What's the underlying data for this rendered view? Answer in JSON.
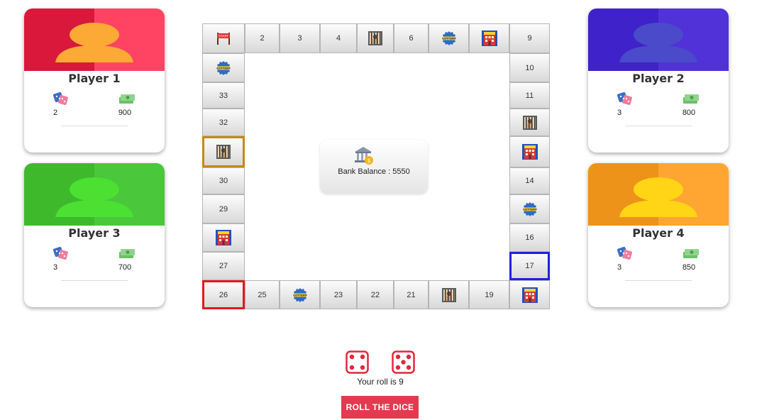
{
  "players": [
    {
      "name": "Player 1",
      "dice": "2",
      "cash": "900",
      "color_left": "#d9183c",
      "color_right": "#ff4463",
      "avatar_color": "#fda935"
    },
    {
      "name": "Player 2",
      "dice": "3",
      "cash": "800",
      "color_left": "#3f22c9",
      "color_right": "#5032d8",
      "avatar_color": "#4a4acb"
    },
    {
      "name": "Player 3",
      "dice": "3",
      "cash": "700",
      "color_left": "#3fb92c",
      "color_right": "#4bc73c",
      "avatar_color": "#4be032"
    },
    {
      "name": "Player 4",
      "dice": "3",
      "cash": "850",
      "color_left": "#ee9319",
      "color_right": "#ffa531",
      "avatar_color": "#ffd516"
    }
  ],
  "board": {
    "top": [
      "start",
      "2",
      "3",
      "4",
      "jail",
      "6",
      "lottery",
      "hotel",
      "9"
    ],
    "right": [
      "10",
      "11",
      "jail",
      "hotel",
      "14",
      "lottery",
      "16",
      "17"
    ],
    "bottom": [
      "hotel",
      "19",
      "jail",
      "21",
      "22",
      "23",
      "lottery",
      "25",
      "26"
    ],
    "left": [
      "27",
      "hotel",
      "29",
      "30",
      "jail",
      "32",
      "33",
      "lottery"
    ]
  },
  "bank": {
    "label": "Bank Balance :  5550"
  },
  "dice": {
    "die1": 4,
    "die2": 5,
    "roll_text": "Your roll is 9"
  },
  "roll_button": {
    "label": "ROLL THE DICE"
  }
}
